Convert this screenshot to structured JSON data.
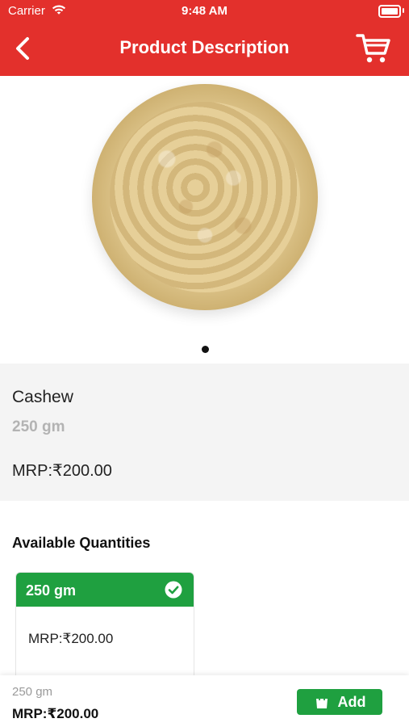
{
  "status_bar": {
    "carrier": "Carrier",
    "time": "9:48 AM"
  },
  "header": {
    "title": "Product Description",
    "background_color": "#e3302c"
  },
  "product": {
    "name": "Cashew",
    "weight": "250 gm",
    "mrp": "MRP:₹200.00",
    "image_icon": "cashew-bowl-image",
    "gallery_dots": 1
  },
  "quantities": {
    "title": "Available Quantities",
    "items": [
      {
        "label": "250 gm",
        "mrp": "MRP:₹200.00",
        "selected": true
      }
    ]
  },
  "bottom_bar": {
    "weight": "250 gm",
    "mrp": "MRP:₹200.00",
    "add_label": "Add",
    "accent_color": "#1fa040"
  }
}
